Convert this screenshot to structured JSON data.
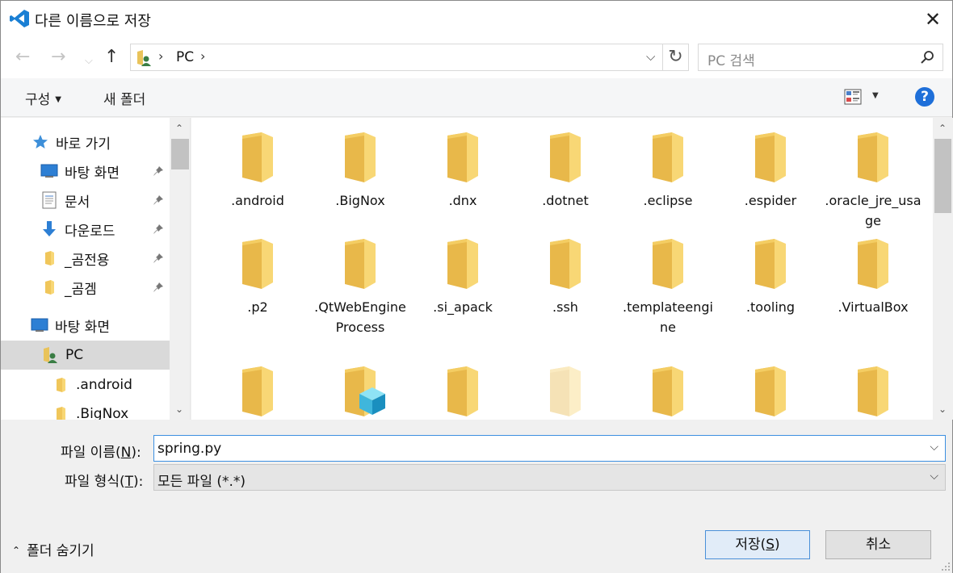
{
  "window": {
    "title": "다른 이름으로 저장",
    "close_label": "✕"
  },
  "nav": {
    "back": "←",
    "forward": "→",
    "recent": "⌵",
    "up": "↑",
    "address": "PC",
    "refresh": "↻",
    "search_placeholder": "PC 검색"
  },
  "toolbar": {
    "organize_label": "구성",
    "new_folder_label": "새 폴더",
    "help_label": "?"
  },
  "sidebar": {
    "items": [
      {
        "label": "바로 가기",
        "icon": "star-icon"
      },
      {
        "label": "바탕 화면",
        "icon": "desktop-icon",
        "pinned": true
      },
      {
        "label": "문서",
        "icon": "document-icon",
        "pinned": true
      },
      {
        "label": "다운로드",
        "icon": "download-icon",
        "pinned": true
      },
      {
        "label": "_곰전용",
        "icon": "folder-icon",
        "pinned": true
      },
      {
        "label": "_곰겜",
        "icon": "folder-icon",
        "pinned": true
      },
      {
        "label": "바탕 화면",
        "icon": "desktop-icon"
      },
      {
        "label": "PC",
        "icon": "pc-icon",
        "selected": true
      },
      {
        "label": ".android",
        "icon": "folder-icon"
      },
      {
        "label": ".BigNox",
        "icon": "folder-icon"
      }
    ]
  },
  "files": [
    {
      "name": ".android"
    },
    {
      "name": ".BigNox"
    },
    {
      "name": ".dnx"
    },
    {
      "name": ".dotnet"
    },
    {
      "name": ".eclipse"
    },
    {
      "name": ".espider"
    },
    {
      "name": ".oracle_jre_usage"
    },
    {
      "name": ".p2"
    },
    {
      "name": ".QtWebEngineProcess"
    },
    {
      "name": ".si_apack"
    },
    {
      "name": ".ssh"
    },
    {
      "name": ".templateengine"
    },
    {
      "name": ".tooling"
    },
    {
      "name": ".VirtualBox"
    },
    {
      "name": ""
    },
    {
      "name": "",
      "overlay": "cube-icon"
    },
    {
      "name": ""
    },
    {
      "name": "",
      "faded": true
    },
    {
      "name": ""
    },
    {
      "name": ""
    },
    {
      "name": ""
    }
  ],
  "form": {
    "filename_label_pre": "파일 이름(",
    "filename_label_key": "N",
    "filename_label_post": "):",
    "filename_value": "spring.py",
    "filetype_label_pre": "파일 형식(",
    "filetype_label_key": "T",
    "filetype_label_post": "):",
    "filetype_value": "모든 파일 (*.*)"
  },
  "footer": {
    "hide_folders_label": "폴더 숨기기",
    "save_label_pre": "저장(",
    "save_label_key": "S",
    "save_label_post": ")",
    "cancel_label": "취소"
  },
  "colors": {
    "accent": "#1e6fd9",
    "folder": "#f8d775",
    "folder_dark": "#e8b84a"
  }
}
